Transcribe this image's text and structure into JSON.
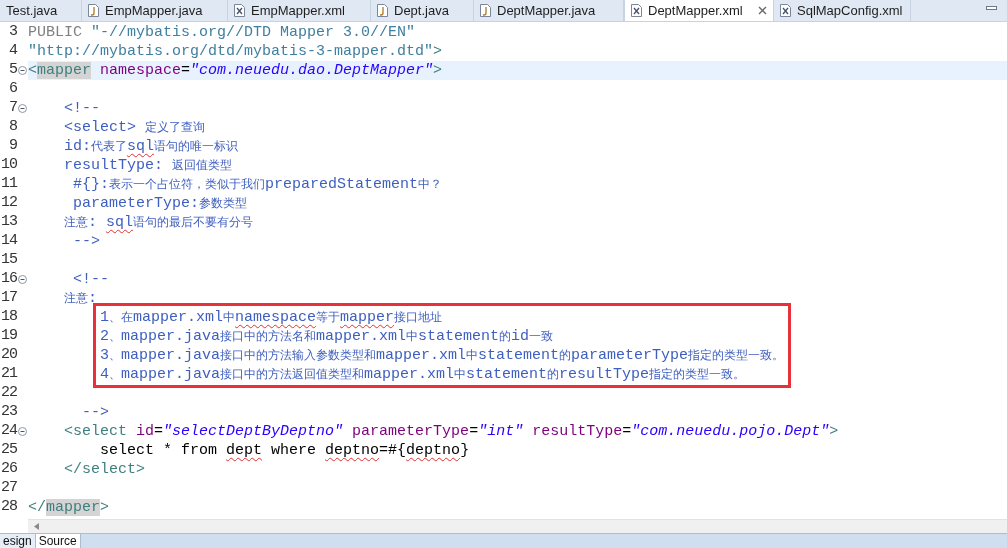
{
  "editor_tabs": [
    {
      "label": "Test.java",
      "selected": false
    },
    {
      "label": "EmpMapper.java",
      "kind": "java",
      "selected": false
    },
    {
      "label": "EmpMapper.xml",
      "kind": "xml",
      "selected": false
    },
    {
      "label": "Dept.java",
      "kind": "java",
      "selected": false
    },
    {
      "label": "DeptMapper.java",
      "kind": "java",
      "selected": false
    },
    {
      "label": "DeptMapper.xml",
      "kind": "xml",
      "selected": true
    },
    {
      "label": "SqlMapConfig.xml",
      "kind": "xml",
      "selected": false
    }
  ],
  "lines": [
    {
      "number": "3",
      "collapsible": false,
      "current": false,
      "boxed": false,
      "segments": [
        {
          "kind": "doctype-keyword",
          "text": "PUBLIC ",
          "spell_error": false
        },
        {
          "kind": "doctype-string",
          "text": "\"-//mybatis.org//DTD Mapper 3.0//EN\"",
          "spell_error": false
        }
      ]
    },
    {
      "number": "4",
      "collapsible": false,
      "current": false,
      "boxed": false,
      "segments": [
        {
          "kind": "doctype-string",
          "text": "\"http://mybatis.org/dtd/mybatis-3-mapper.dtd\"",
          "spell_error": false
        },
        {
          "kind": "tag",
          "text": ">",
          "spell_error": false
        }
      ]
    },
    {
      "number": "5",
      "collapsible": true,
      "current": true,
      "boxed": false,
      "segments": [
        {
          "kind": "tag",
          "text": "<",
          "spell_error": false
        },
        {
          "kind": "tag-match",
          "text": "mapper",
          "spell_error": false
        },
        {
          "kind": "attr",
          "text": " namespace",
          "spell_error": false
        },
        {
          "kind": "text",
          "text": "=",
          "spell_error": false
        },
        {
          "kind": "value",
          "text": "\"com.neuedu.dao.DeptMapper\"",
          "spell_error": false
        },
        {
          "kind": "tag",
          "text": ">",
          "spell_error": false
        }
      ]
    },
    {
      "number": "6",
      "collapsible": false,
      "current": false,
      "boxed": false
    },
    {
      "number": "7",
      "collapsible": true,
      "current": false,
      "boxed": false,
      "segments": [
        {
          "kind": "comment",
          "text": "    <!--",
          "spell_error": false
        }
      ]
    },
    {
      "number": "8",
      "collapsible": false,
      "current": false,
      "boxed": false,
      "segments": [
        {
          "kind": "comment",
          "text": "    <select> 定义了查询",
          "spell_error": false
        }
      ]
    },
    {
      "number": "9",
      "collapsible": false,
      "current": false,
      "boxed": false,
      "segments": [
        {
          "kind": "comment",
          "text": "    id:代表了",
          "spell_error": false
        },
        {
          "kind": "comment",
          "text": "sql",
          "spell_error": true
        },
        {
          "kind": "comment",
          "text": "语句的唯一标识",
          "spell_error": false
        }
      ]
    },
    {
      "number": "10",
      "collapsible": false,
      "current": false,
      "boxed": false,
      "segments": [
        {
          "kind": "comment",
          "text": "    resultType: 返回值类型",
          "spell_error": false
        }
      ]
    },
    {
      "number": "11",
      "collapsible": false,
      "current": false,
      "boxed": false,
      "segments": [
        {
          "kind": "comment",
          "text": "     #{}:表示一个占位符，类似于我们preparedStatement中？",
          "spell_error": false
        }
      ]
    },
    {
      "number": "12",
      "collapsible": false,
      "current": false,
      "boxed": false,
      "segments": [
        {
          "kind": "comment",
          "text": "     parameterType:参数类型",
          "spell_error": false
        }
      ]
    },
    {
      "number": "13",
      "collapsible": false,
      "current": false,
      "boxed": false,
      "segments": [
        {
          "kind": "comment",
          "text": "    注意: ",
          "spell_error": false
        },
        {
          "kind": "comment",
          "text": "sql",
          "spell_error": true
        },
        {
          "kind": "comment",
          "text": "语句的最后不要有分号",
          "spell_error": false
        }
      ]
    },
    {
      "number": "14",
      "collapsible": false,
      "current": false,
      "boxed": false,
      "segments": [
        {
          "kind": "comment",
          "text": "     -->",
          "spell_error": false
        }
      ]
    },
    {
      "number": "15",
      "collapsible": false,
      "current": false,
      "boxed": false
    },
    {
      "number": "16",
      "collapsible": true,
      "current": false,
      "boxed": false,
      "segments": [
        {
          "kind": "comment",
          "text": "     <!--",
          "spell_error": false
        }
      ]
    },
    {
      "number": "17",
      "collapsible": false,
      "current": false,
      "boxed": false,
      "segments": [
        {
          "kind": "comment",
          "text": "    注意:",
          "spell_error": false
        }
      ]
    },
    {
      "number": "18",
      "collapsible": false,
      "current": false,
      "boxed": true,
      "segments": [
        {
          "kind": "comment",
          "text": "        1、在mapper.xml中",
          "spell_error": false
        },
        {
          "kind": "comment",
          "text": "namespace",
          "spell_error": true
        },
        {
          "kind": "comment",
          "text": "等于",
          "spell_error": false
        },
        {
          "kind": "comment",
          "text": "mapper",
          "spell_error": true
        },
        {
          "kind": "comment",
          "text": "接口地址",
          "spell_error": false
        }
      ]
    },
    {
      "number": "19",
      "collapsible": false,
      "current": false,
      "boxed": true,
      "segments": [
        {
          "kind": "comment",
          "text": "        2、mapper.java接口中的方法名和mapper.xml中statement的id一致",
          "spell_error": false
        }
      ]
    },
    {
      "number": "20",
      "collapsible": false,
      "current": false,
      "boxed": true,
      "segments": [
        {
          "kind": "comment",
          "text": "        3、mapper.java接口中的方法输入参数类型和mapper.xml中statement的parameterType指定的类型一致。",
          "spell_error": false
        }
      ]
    },
    {
      "number": "21",
      "collapsible": false,
      "current": false,
      "boxed": true,
      "segments": [
        {
          "kind": "comment",
          "text": "        4、mapper.java接口中的方法返回值类型和mapper.xml中statement的resultType指定的类型一致。",
          "spell_error": false
        }
      ]
    },
    {
      "number": "22",
      "collapsible": false,
      "current": false,
      "boxed": false
    },
    {
      "number": "23",
      "collapsible": false,
      "current": false,
      "boxed": false,
      "segments": [
        {
          "kind": "comment",
          "text": "      -->",
          "spell_error": false
        }
      ]
    },
    {
      "number": "24",
      "collapsible": true,
      "current": false,
      "boxed": false,
      "segments": [
        {
          "kind": "tag",
          "text": "    <select",
          "spell_error": false
        },
        {
          "kind": "attr",
          "text": " id",
          "spell_error": false
        },
        {
          "kind": "text",
          "text": "=",
          "spell_error": false
        },
        {
          "kind": "value",
          "text": "\"selectDeptByDeptno\"",
          "spell_error": false
        },
        {
          "kind": "attr",
          "text": " parameterType",
          "spell_error": false
        },
        {
          "kind": "text",
          "text": "=",
          "spell_error": false
        },
        {
          "kind": "value",
          "text": "\"int\"",
          "spell_error": false
        },
        {
          "kind": "attr",
          "text": " resultType",
          "spell_error": false
        },
        {
          "kind": "text",
          "text": "=",
          "spell_error": false
        },
        {
          "kind": "value",
          "text": "\"com.neuedu.pojo.Dept\"",
          "spell_error": false
        },
        {
          "kind": "tag",
          "text": ">",
          "spell_error": false
        }
      ]
    },
    {
      "number": "25",
      "collapsible": false,
      "current": false,
      "boxed": false,
      "segments": [
        {
          "kind": "text",
          "text": "        select * from ",
          "spell_error": false
        },
        {
          "kind": "text",
          "text": "dept",
          "spell_error": true
        },
        {
          "kind": "text",
          "text": " where ",
          "spell_error": false
        },
        {
          "kind": "text",
          "text": "deptno",
          "spell_error": true
        },
        {
          "kind": "text",
          "text": "=#{",
          "spell_error": false
        },
        {
          "kind": "text",
          "text": "deptno",
          "spell_error": true
        },
        {
          "kind": "text",
          "text": "}",
          "spell_error": false
        }
      ]
    },
    {
      "number": "26",
      "collapsible": false,
      "current": false,
      "boxed": false,
      "segments": [
        {
          "kind": "tag",
          "text": "    </select>",
          "spell_error": false
        }
      ]
    },
    {
      "number": "27",
      "collapsible": false,
      "current": false,
      "boxed": false
    },
    {
      "number": "28",
      "collapsible": false,
      "current": false,
      "boxed": false,
      "segments": [
        {
          "kind": "tag",
          "text": "</",
          "spell_error": false
        },
        {
          "kind": "tag-match",
          "text": "mapper",
          "spell_error": false
        },
        {
          "kind": "tag",
          "text": ">",
          "spell_error": false
        }
      ]
    }
  ],
  "view_tabs": [
    {
      "label": "esign",
      "selected": false
    },
    {
      "label": "Source",
      "selected": true
    }
  ]
}
